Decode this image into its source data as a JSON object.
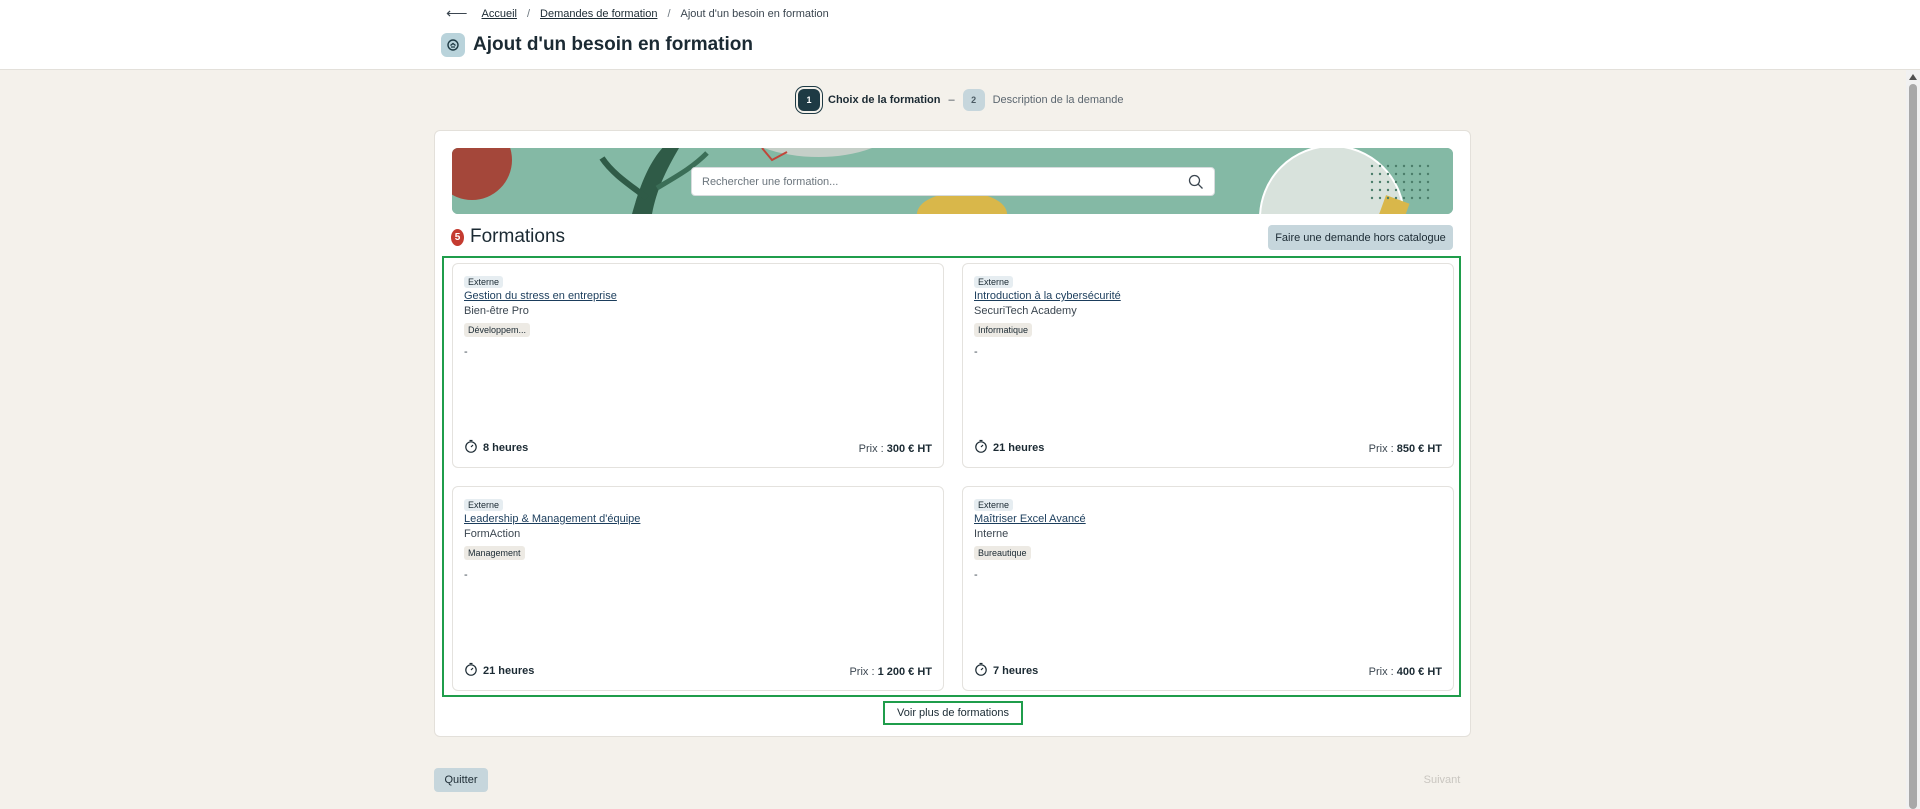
{
  "breadcrumb": {
    "items": [
      "Accueil",
      "Demandes de formation",
      "Ajout d'un besoin en formation"
    ]
  },
  "page_title": "Ajout d'un besoin en formation",
  "stepper": {
    "steps": [
      {
        "number": "1",
        "label": "Choix de la formation"
      },
      {
        "number": "2",
        "label": "Description de la demande"
      }
    ],
    "separator": "–"
  },
  "search": {
    "placeholder": "Rechercher une formation..."
  },
  "formations": {
    "count": "5",
    "title": "Formations",
    "hors_catalogue_label": "Faire une demande hors catalogue",
    "cards": [
      {
        "type": "Externe",
        "title": "Gestion du stress en entreprise",
        "provider": "Bien-être Pro",
        "category": "Développem...",
        "description": "-",
        "duration": "8 heures",
        "price_prefix": "Prix : ",
        "price": "300 € HT"
      },
      {
        "type": "Externe",
        "title": "Introduction à la cybersécurité",
        "provider": "SecuriTech Academy",
        "category": "Informatique",
        "description": "-",
        "duration": "21 heures",
        "price_prefix": "Prix : ",
        "price": "850 € HT"
      },
      {
        "type": "Externe",
        "title": "Leadership & Management d'équipe",
        "provider": "FormAction",
        "category": "Management",
        "description": "-",
        "duration": "21 heures",
        "price_prefix": "Prix : ",
        "price": "1 200 € HT"
      },
      {
        "type": "Externe",
        "title": "Maîtriser Excel Avancé",
        "provider": "Interne",
        "category": "Bureautique",
        "description": "-",
        "duration": "7 heures",
        "price_prefix": "Prix : ",
        "price": "400 € HT"
      }
    ],
    "more_label": "Voir plus de formations"
  },
  "footer": {
    "quit_label": "Quitter",
    "next_label": "Suivant"
  },
  "colors": {
    "accent_dark": "#1e3a44",
    "accent_light": "#c6d6dc",
    "highlight": "#1f9d4b",
    "badge": "#c43b30"
  }
}
